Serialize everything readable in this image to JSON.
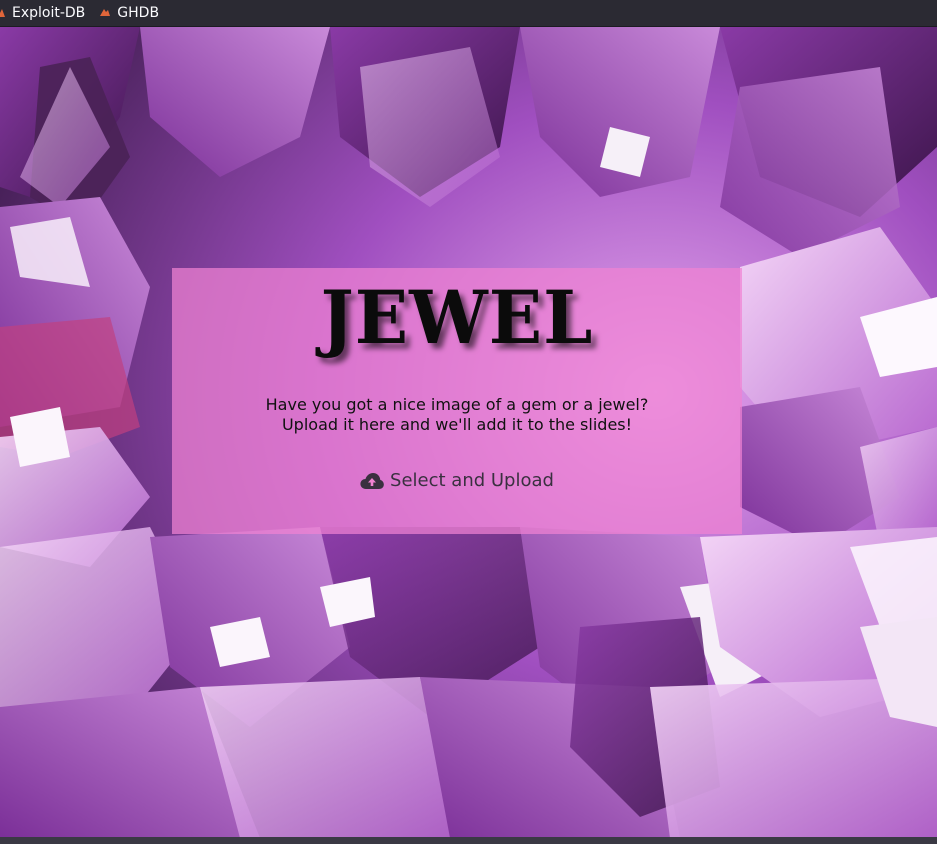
{
  "bookmarks": [
    {
      "label": "Exploit-DB",
      "icon": "exploit-db-icon"
    },
    {
      "label": "GHDB",
      "icon": "ghdb-icon"
    }
  ],
  "page": {
    "title": "JEWEL",
    "subtitle_line1": "Have you got a nice image of a gem or a jewel?",
    "subtitle_line2": "Upload it here and we'll add it to the slides!",
    "upload_label": "Select and Upload",
    "upload_icon": "cloud-upload-icon",
    "background": "amethyst-crystals-image"
  },
  "colors": {
    "panel": "#f082d2",
    "title": "#0b0b0b",
    "bookmark_bar": "#2b2a33",
    "bookmark_icon": "#e0653a"
  }
}
